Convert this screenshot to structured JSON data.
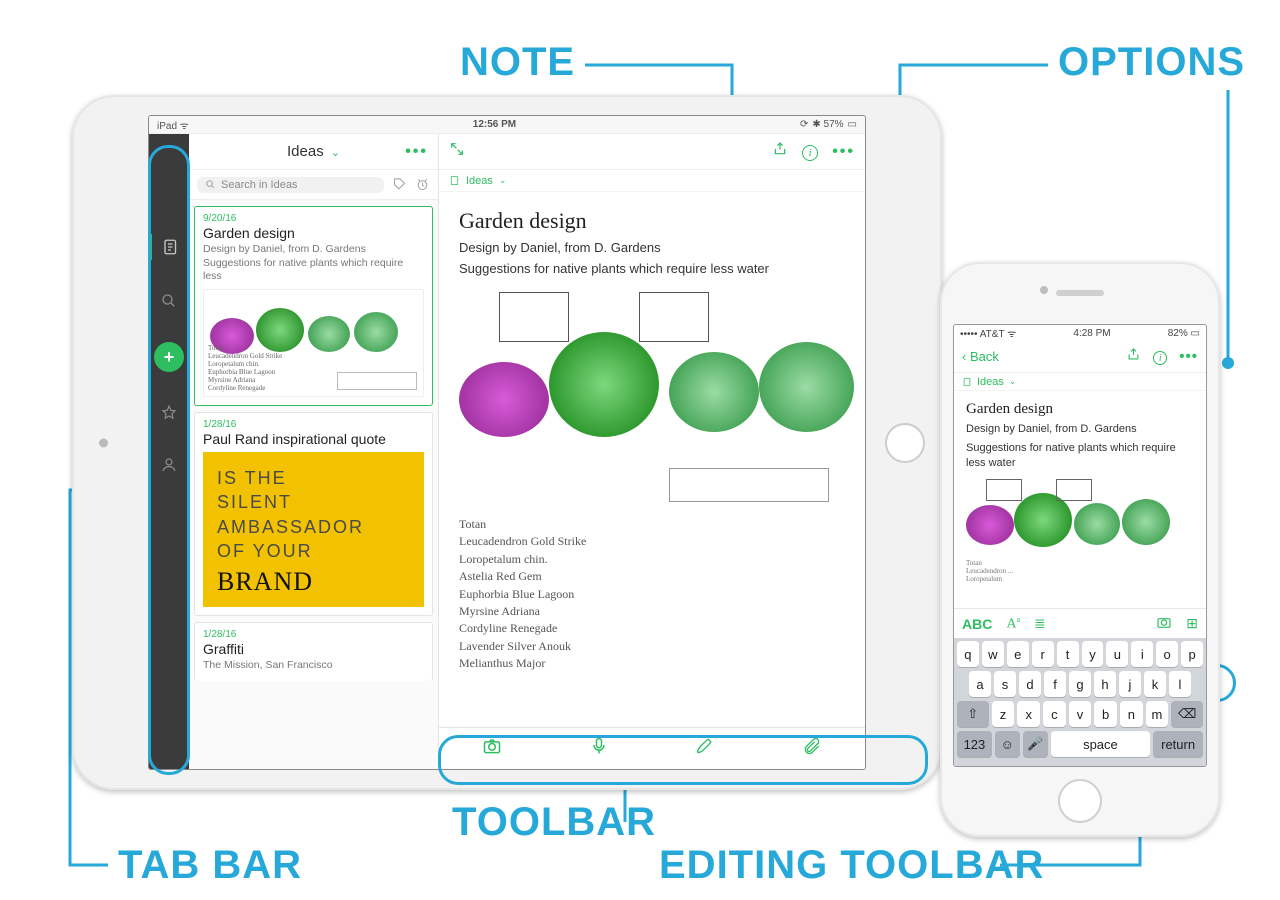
{
  "callouts": {
    "note": "NOTE",
    "options": "OPTIONS",
    "toolbar": "TOOLBAR",
    "tabbar": "TAB BAR",
    "editing": "EDITING TOOLBAR"
  },
  "ipad": {
    "status": {
      "left": "iPad ᯤ",
      "time": "12:56 PM",
      "right": "✱ 57%"
    },
    "list": {
      "header_title": "Ideas",
      "header_more": "•••",
      "search_placeholder": "Search in Ideas",
      "items": [
        {
          "date": "9/20/16",
          "title": "Garden design",
          "sub": "Design by Daniel, from D. Gardens\nSuggestions for native plants which require less"
        },
        {
          "date": "1/28/16",
          "title": "Paul Rand inspirational quote",
          "quote_lines": "IS THE\nSILENT\nAMBASSADOR\nOF YOUR",
          "quote_brand": "BRAND"
        },
        {
          "date": "1/28/16",
          "title": "Graffiti",
          "sub": "The Mission, San Francisco"
        }
      ]
    },
    "note": {
      "crumb": "Ideas",
      "title": "Garden design",
      "lines": [
        "Design by Daniel, from D. Gardens",
        "Suggestions for native plants which require less water"
      ],
      "handwriting": "Totan\nLeucadendron Gold Strike\nLoropetalum chin.\nAstelia Red Gem\nEuphorbia Blue Lagoon\nMyrsine Adriana\nCordyline Renegade\nLavender Silver Anouk\nMelianthus Major"
    },
    "toolbar_icons": [
      "camera-icon",
      "mic-icon",
      "pen-icon",
      "attach-icon"
    ]
  },
  "iphone": {
    "status": {
      "carrier": "••••• AT&T ᯤ",
      "time": "4:28 PM",
      "batt": "82%"
    },
    "top": {
      "back": "Back",
      "icons": [
        "share-icon",
        "info-icon",
        "more-icon"
      ]
    },
    "crumb": "Ideas",
    "note": {
      "title": "Garden design",
      "lines": [
        "Design by Daniel, from D. Gardens",
        "Suggestions for native plants which require less water"
      ]
    },
    "edit_icons": {
      "abc": "ABC",
      "format": "A",
      "list": "≣",
      "camera": "camera-icon",
      "add": "⊞"
    },
    "keyboard": {
      "rows": [
        [
          "q",
          "w",
          "e",
          "r",
          "t",
          "y",
          "u",
          "i",
          "o",
          "p"
        ],
        [
          "a",
          "s",
          "d",
          "f",
          "g",
          "h",
          "j",
          "k",
          "l"
        ],
        [
          "⇧",
          "z",
          "x",
          "c",
          "v",
          "b",
          "n",
          "m",
          "⌫"
        ]
      ],
      "bottom": {
        "num": "123",
        "emoji": "☺",
        "mic": "🎤",
        "space": "space",
        "return": "return"
      }
    }
  }
}
